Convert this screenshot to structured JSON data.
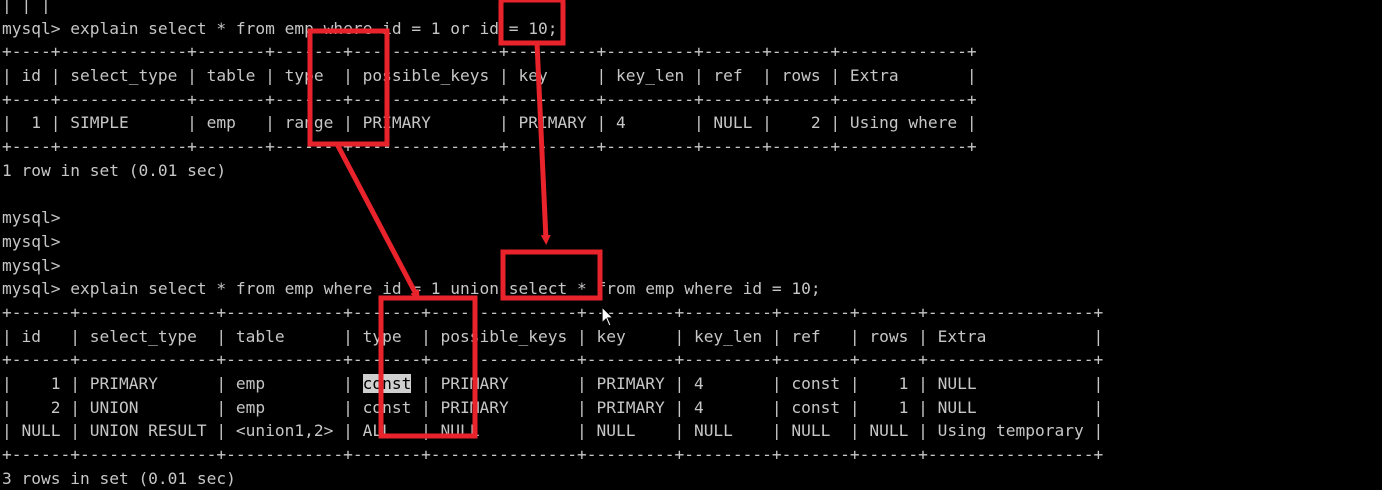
{
  "terminal": {
    "lines": [
      {
        "kind": "text",
        "text": "| | |"
      },
      {
        "kind": "text",
        "text": "mysql> explain select * from emp where id = 1 or id = 10;"
      },
      {
        "kind": "border",
        "text": "+----+-------------+-------+-------+---------------+---------+---------+------+------+-------------+"
      },
      {
        "kind": "text",
        "text": "| id | select_type | table | type  | possible_keys | key     | key_len | ref  | rows | Extra       |"
      },
      {
        "kind": "border",
        "text": "+----+-------------+-------+-------+---------------+---------+---------+------+------+-------------+"
      },
      {
        "kind": "text",
        "text": "|  1 | SIMPLE      | emp   | range | PRIMARY       | PRIMARY | 4       | NULL |    2 | Using where |"
      },
      {
        "kind": "border",
        "text": "+----+-------------+-------+-------+---------------+---------+---------+------+------+-------------+"
      },
      {
        "kind": "text",
        "text": "1 row in set (0.01 sec)"
      },
      {
        "kind": "text",
        "text": ""
      },
      {
        "kind": "text",
        "text": "mysql>"
      },
      {
        "kind": "text",
        "text": "mysql>"
      },
      {
        "kind": "text",
        "text": "mysql>"
      },
      {
        "kind": "text",
        "text": "mysql> explain select * from emp where id = 1 union select * from emp where id = 10;"
      },
      {
        "kind": "border",
        "text": "+------+--------------+------------+-------+---------------+---------+---------+-------+------+-----------------+"
      },
      {
        "kind": "text",
        "text": "| id   | select_type  | table      | type  | possible_keys | key     | key_len | ref   | rows | Extra           |"
      },
      {
        "kind": "border",
        "text": "+------+--------------+------------+-------+---------------+---------+---------+-------+------+-----------------+"
      },
      {
        "kind": "text",
        "text": "|    1 | PRIMARY      | emp        | const | PRIMARY       | PRIMARY | 4       | const |    1 | NULL            |",
        "highlight": "const"
      },
      {
        "kind": "text",
        "text": "|    2 | UNION        | emp        | const | PRIMARY       | PRIMARY | 4       | const |    1 | NULL            |"
      },
      {
        "kind": "text",
        "text": "| NULL | UNION RESULT | <union1,2> | ALL   | NULL          | NULL    | NULL    | NULL  | NULL | Using temporary |"
      },
      {
        "kind": "border",
        "text": "+------+--------------+------------+-------+---------------+---------+---------+-------+------+-----------------+"
      },
      {
        "kind": "text",
        "text": "3 rows in set (0.01 sec)"
      }
    ]
  },
  "annotations": {
    "color": "#e8232b"
  }
}
